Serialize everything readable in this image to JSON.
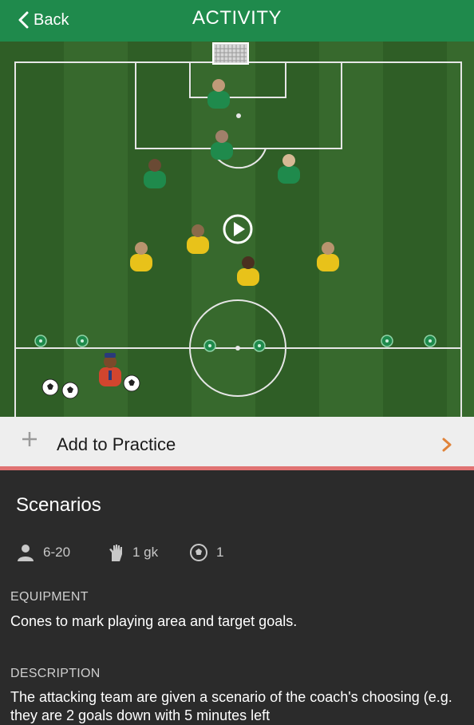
{
  "header": {
    "back_label": "Back",
    "title": "ACTIVITY"
  },
  "colors": {
    "header_bg": "#1f8a4c",
    "pitch_dark": "#2f5e26",
    "pitch_light": "#3a6b2f",
    "team_green": "#1f8a4c",
    "team_yellow": "#e8c21a",
    "accent_line": "#e07272",
    "chevron": "#e0833a"
  },
  "actions": {
    "add_label": "Add to Practice"
  },
  "activity": {
    "name": "Scenarios",
    "stats": {
      "players": "6-20",
      "goalkeepers": "1 gk",
      "balls": "1"
    },
    "equipment_title": "EQUIPMENT",
    "equipment_text": "Cones to mark playing area and target goals.",
    "description_title": "DESCRIPTION",
    "description_text": "The attacking team are given a scenario of the coach's choosing (e.g. they are 2 goals down with 5 minutes left"
  },
  "icons": {
    "back": "chevron-left-icon",
    "play": "play-icon",
    "add": "plus-icon",
    "next": "chevron-right-icon",
    "players": "person-icon",
    "goalkeeper": "glove-icon",
    "ball": "soccer-ball-icon"
  }
}
